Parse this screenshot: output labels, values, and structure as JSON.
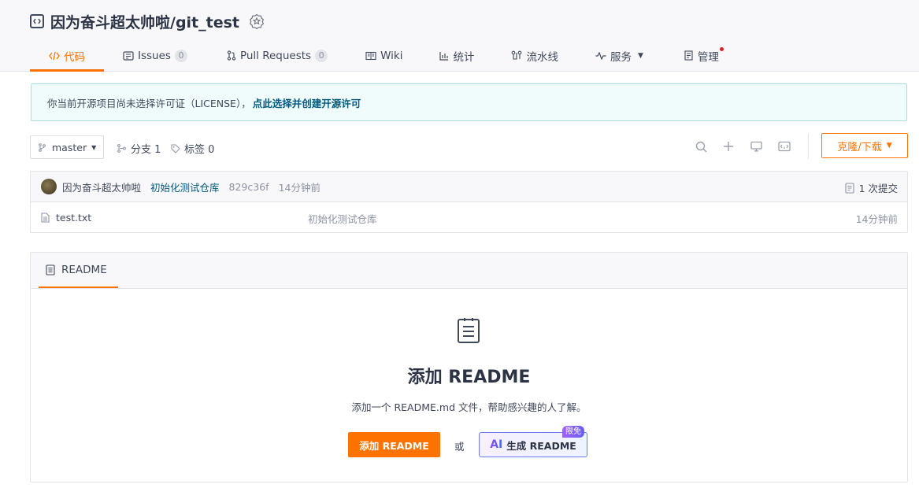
{
  "repo": {
    "title": "因为奋斗超太帅啦/git_test",
    "icon": "code-bracket-icon",
    "badge_icon": "recommend-badge-icon"
  },
  "tabs": [
    {
      "label": "代码",
      "icon": "code-icon",
      "active": true
    },
    {
      "label": "Issues",
      "icon": "issues-icon",
      "count": "0"
    },
    {
      "label": "Pull Requests",
      "icon": "pull-request-icon",
      "count": "0"
    },
    {
      "label": "Wiki",
      "icon": "wiki-icon"
    },
    {
      "label": "统计",
      "icon": "bar-chart-icon"
    },
    {
      "label": "流水线",
      "icon": "pipeline-icon"
    },
    {
      "label": "服务",
      "icon": "pulse-icon",
      "dropdown": true
    },
    {
      "label": "管理",
      "icon": "manage-icon",
      "dot": true
    }
  ],
  "notice": {
    "text": "你当前开源项目尚未选择许可证（LICENSE），",
    "link": "点此选择并创建开源许可"
  },
  "toolbar": {
    "branch": "master",
    "branches_label": "分支 1",
    "tags_label": "标签 0",
    "clone_label": "克隆/下载"
  },
  "commit": {
    "author": "因为奋斗超太帅啦",
    "message": "初始化测试仓库",
    "hash": "829c36f",
    "time": "14分钟前",
    "count_label": "1 次提交"
  },
  "files": [
    {
      "name": "test.txt",
      "message": "初始化测试仓库",
      "time": "14分钟前"
    }
  ],
  "readme": {
    "tab_label": "README",
    "empty_title": "添加 README",
    "empty_desc": "添加一个 README.md 文件，帮助感兴趣的人了解。",
    "add_button": "添加 README",
    "or_text": "或",
    "ai_mark": "AI",
    "ai_button": "生成 README",
    "free_tag": "限免"
  },
  "colors": {
    "accent": "#fe7300",
    "link": "#005980",
    "notice_bg": "#f0fbfb"
  }
}
